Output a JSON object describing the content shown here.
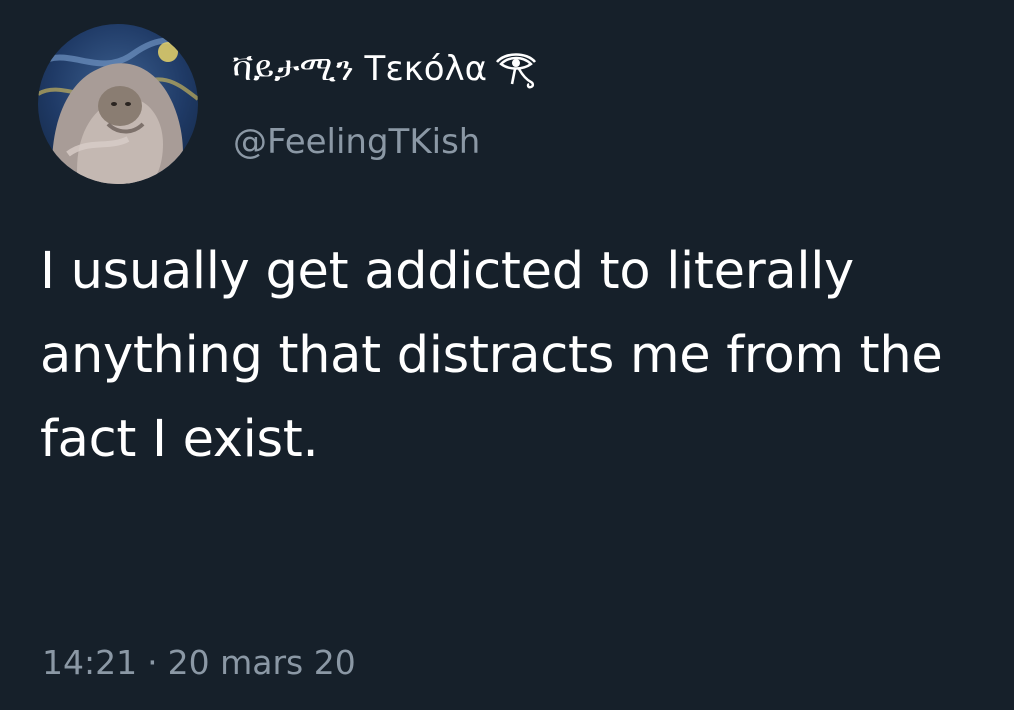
{
  "tweet": {
    "author": {
      "display_name": "ቫይታሚን Τεκόλα",
      "name_emoji_icon": "eye-of-horus-icon",
      "handle": "@FeelingTKish",
      "avatar": "starry-night-cat-avatar"
    },
    "text": "I usually get addicted to literally anything that distracts me from the fact I exist.",
    "time": "14:21",
    "separator": "·",
    "date": "20 mars 20"
  },
  "colors": {
    "background": "#16202a",
    "primary_text": "#ffffff",
    "secondary_text": "#8b98a5"
  }
}
